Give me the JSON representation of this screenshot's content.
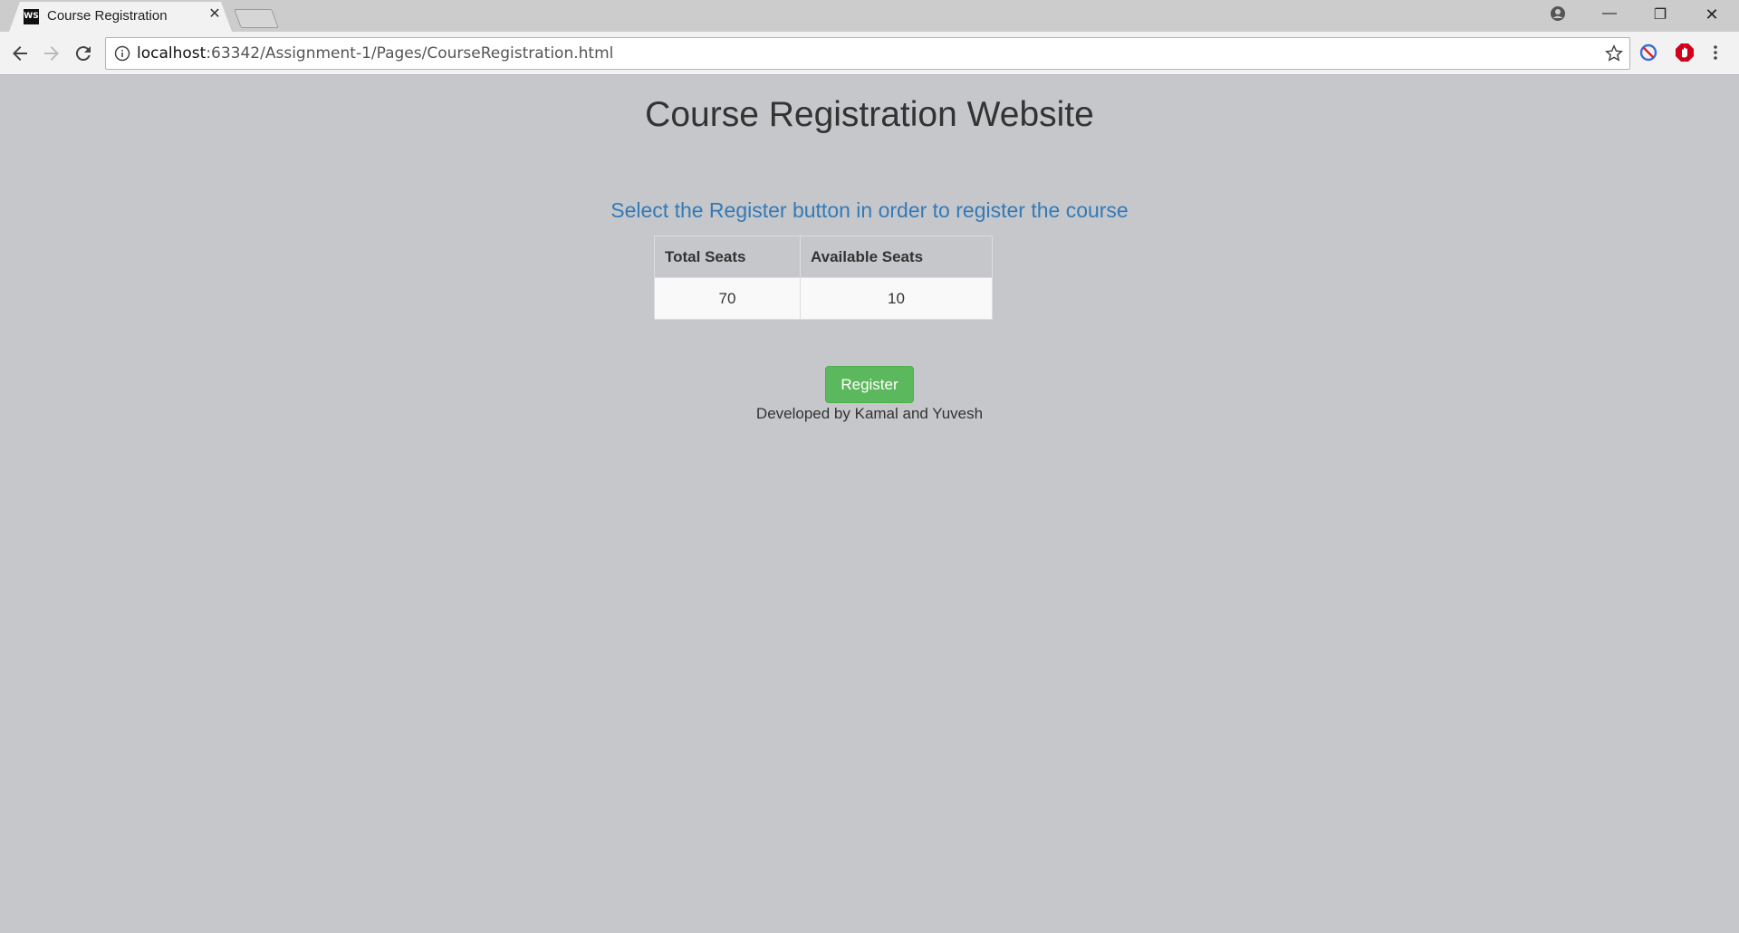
{
  "browser": {
    "tab": {
      "title": "Course Registration",
      "favicon_text": "WS",
      "close_glyph": "✕"
    },
    "address_bar": {
      "host": "localhost",
      "path": ":63342/Assignment-1/Pages/CourseRegistration.html"
    },
    "icons": [
      "back-icon",
      "forward-icon",
      "reload-icon",
      "info-icon",
      "star-icon",
      "block-extension-icon",
      "adblock-extension-icon",
      "menu-icon",
      "profile-icon"
    ],
    "window_controls": {
      "minimize": "—",
      "restore": "❐",
      "close": "✕"
    }
  },
  "page": {
    "title": "Course Registration Website",
    "subtitle": "Select the Register button in order to register the course",
    "table": {
      "headers": [
        "Total Seats",
        "Available Seats"
      ],
      "rows": [
        [
          "70",
          "10"
        ]
      ]
    },
    "register_label": "Register",
    "footer": "Developed by Kamal and Yuvesh"
  },
  "colors": {
    "page_background": "#c6c7ca",
    "subtitle": "#337ab7",
    "button": "#5cb85c"
  }
}
